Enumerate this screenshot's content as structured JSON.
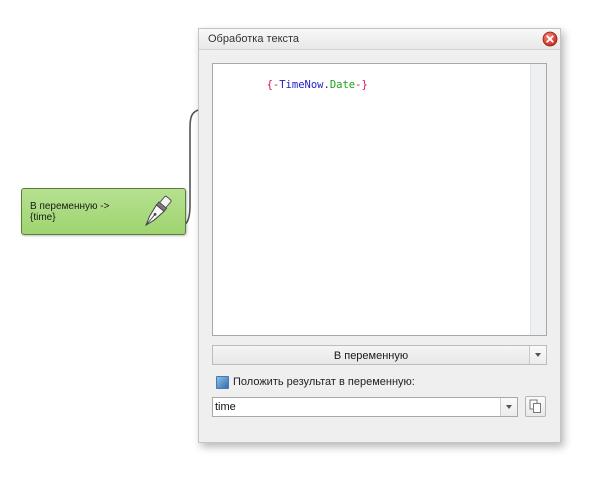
{
  "node": {
    "label": "В переменную ->\n{time}",
    "icon": "pen-nib-icon",
    "fill_color": "#a6d97a",
    "border_color": "#5b7d3a"
  },
  "dialog": {
    "title": "Обработка текста",
    "close_icon": "close-icon",
    "editor": {
      "tokens": [
        {
          "text": "{-",
          "color": "#d4145a"
        },
        {
          "text": "TimeNow",
          "color": "#1f1fc4"
        },
        {
          "text": ".",
          "color": "#333333"
        },
        {
          "text": "Date",
          "color": "#16a316"
        },
        {
          "text": "-}",
          "color": "#d4145a"
        }
      ]
    },
    "mode_select": {
      "value": "В переменную"
    },
    "put_result_checkbox": {
      "label": "Положить результат в переменную:",
      "checked": true
    },
    "variable_field": {
      "value": "time"
    },
    "copy_button_icon": "copy-icon"
  }
}
